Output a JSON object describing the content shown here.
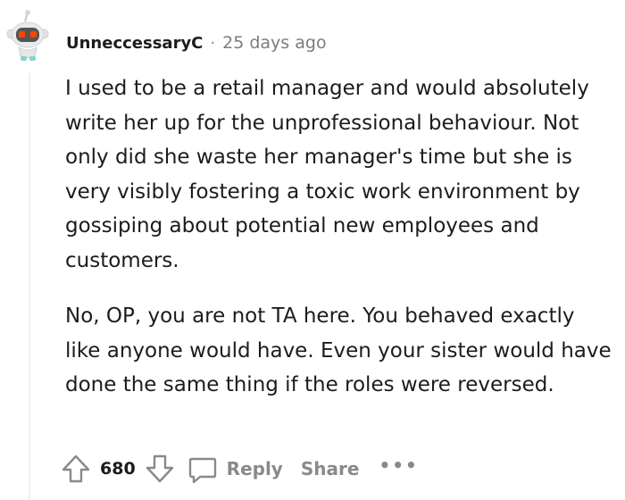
{
  "comment": {
    "username": "UnneccessaryC",
    "separator": "·",
    "timestamp": "25 days ago",
    "paragraphs": [
      "I used to be a retail manager and would absolutely write her up for the unprofessional behaviour. Not only did she waste her manager's time but she is very visibly fostering a toxic work environment by gossiping about potential new employees and customers.",
      "No, OP, you are not TA here. You behaved exactly like anyone would have. Even your sister would have done the same thing if the roles were reversed."
    ],
    "score": "680",
    "reply_label": "Reply",
    "share_label": "Share",
    "more_label": "•••"
  },
  "icons": {
    "avatar": "snoo-avatar-icon",
    "upvote": "upvote-arrow-icon",
    "downvote": "downvote-arrow-icon",
    "reply": "speech-bubble-icon"
  },
  "colors": {
    "muted": "#878a8c",
    "thread_line": "#edeff1",
    "text": "#1c1c1c"
  }
}
